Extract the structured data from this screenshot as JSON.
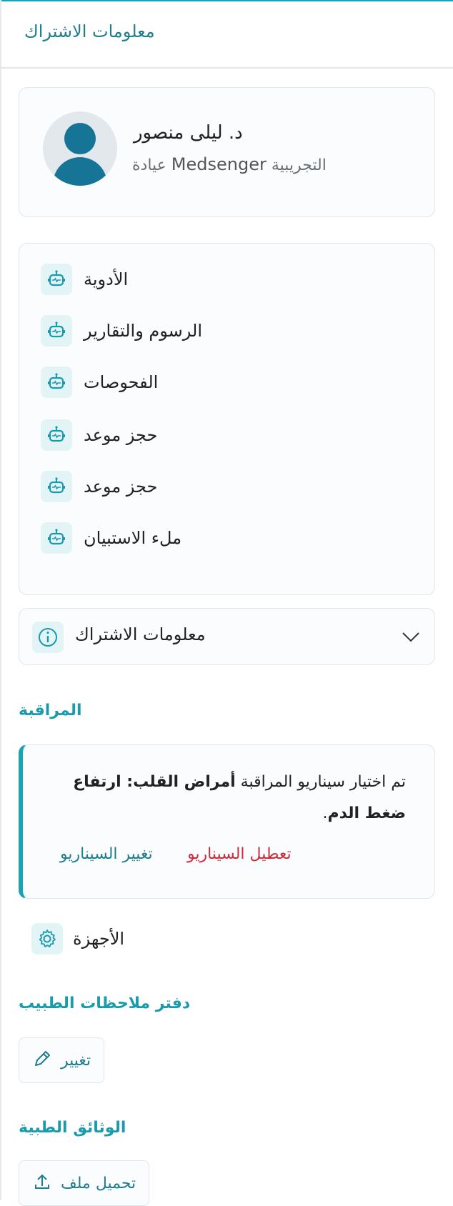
{
  "header": {
    "title": "معلومات الاشتراك"
  },
  "profile": {
    "name": "د. ليلى منصور",
    "clinic_prefix": "التجريبية",
    "clinic_brand": "Medsenger",
    "clinic_suffix": "عيادة"
  },
  "services": [
    {
      "label": "الأدوية",
      "icon": "robot-icon"
    },
    {
      "label": "الرسوم والتقارير",
      "icon": "robot-icon"
    },
    {
      "label": "الفحوصات",
      "icon": "robot-icon"
    },
    {
      "label": "حجز موعد",
      "icon": "robot-icon"
    },
    {
      "label": "حجز موعد",
      "icon": "robot-icon"
    },
    {
      "label": "ملء الاستبيان",
      "icon": "robot-icon"
    }
  ],
  "subscription_info": {
    "label": "معلومات الاشتراك",
    "icon": "info-icon"
  },
  "monitoring": {
    "title": "المراقبة",
    "text_prefix": "تم اختيار سيناريو المراقبة",
    "scenario_name": "أمراض القلب: ارتفاع ضغط الدم",
    "text_suffix": ".",
    "disable_label": "تعطيل السيناريو",
    "change_label": "تغيير السيناريو"
  },
  "devices": {
    "label": "الأجهزة",
    "icon": "gear-icon"
  },
  "notebook": {
    "title": "دفتر ملاحظات الطبيب",
    "edit_label": "تغيير",
    "icon": "pencil-icon"
  },
  "documents": {
    "title": "الوثائق الطبية",
    "upload_label": "تحميل ملف",
    "icon": "upload-icon"
  },
  "colors": {
    "accent": "#1aa3b3",
    "link": "#1f7e8c",
    "danger": "#d0293a",
    "avatar": "#167596"
  }
}
